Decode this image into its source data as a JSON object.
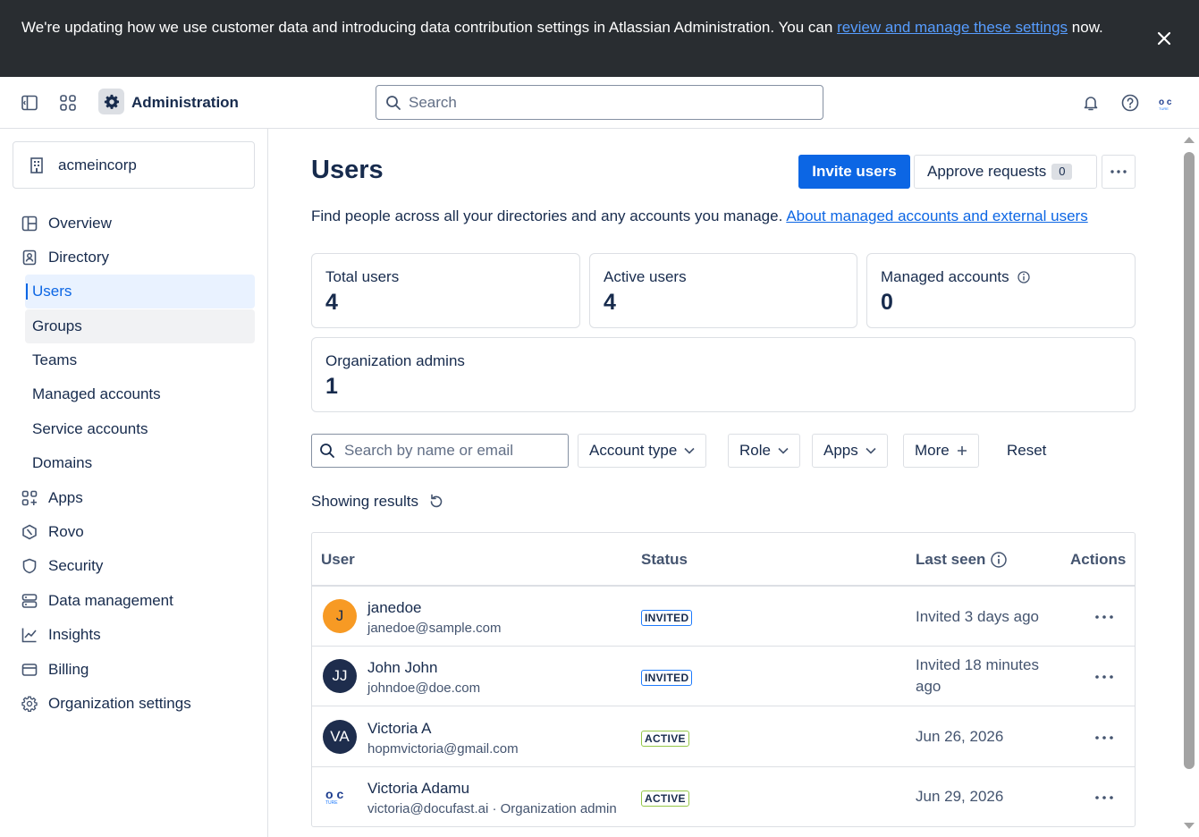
{
  "banner": {
    "text_before": "We're updating how we use customer data and introducing data contribution settings in Atlassian Administration. You can ",
    "link": "review and manage these settings",
    "text_after": " now."
  },
  "topbar": {
    "title": "Administration",
    "search_placeholder": "Search"
  },
  "sidebar": {
    "org": "acmeincorp",
    "items": {
      "overview": "Overview",
      "directory": "Directory",
      "users": "Users",
      "groups": "Groups",
      "teams": "Teams",
      "managed_accounts": "Managed accounts",
      "service_accounts": "Service accounts",
      "domains": "Domains",
      "apps": "Apps",
      "rovo": "Rovo",
      "security": "Security",
      "data_management": "Data management",
      "insights": "Insights",
      "billing": "Billing",
      "org_settings": "Organization settings"
    }
  },
  "main": {
    "title": "Users",
    "invite_label": "Invite users",
    "approve_label": "Approve requests",
    "approve_count": "0",
    "description": "Find people across all your directories and any accounts you manage.",
    "description_link": "About managed accounts and external users",
    "stats": {
      "total_label": "Total users",
      "total_value": "4",
      "active_label": "Active users",
      "active_value": "4",
      "managed_label": "Managed accounts",
      "managed_value": "0",
      "admins_label": "Organization admins",
      "admins_value": "1"
    },
    "filters": {
      "search_placeholder": "Search by name or email",
      "account_type": "Account type",
      "role": "Role",
      "apps": "Apps",
      "more": "More",
      "reset": "Reset"
    },
    "showing": "Showing results",
    "table": {
      "headers": {
        "user": "User",
        "status": "Status",
        "last_seen": "Last seen",
        "actions": "Actions"
      },
      "rows": [
        {
          "initials": "J",
          "name": "janedoe",
          "email": "janedoe@sample.com",
          "status": "INVITED",
          "last_seen": "Invited 3 days ago",
          "avatar_color": "#f79a24"
        },
        {
          "initials": "JJ",
          "name": "John John",
          "email": "johndoe@doe.com",
          "status": "INVITED",
          "last_seen": "Invited 18 minutes ago",
          "avatar_color": "#1e2d4d"
        },
        {
          "initials": "VA",
          "name": "Victoria A",
          "email": "hopmvictoria@gmail.com",
          "status": "ACTIVE",
          "last_seen": "Jun 26, 2026",
          "avatar_color": "#1e2d4d"
        },
        {
          "initials": "",
          "name": "Victoria Adamu",
          "email": "victoria@docufast.ai · Organization admin",
          "status": "ACTIVE",
          "last_seen": "Jun 29, 2026",
          "avatar_color": "#ffffff"
        }
      ]
    }
  },
  "colors": {
    "primary": "#0c66e4",
    "banner_bg": "#292d31"
  }
}
